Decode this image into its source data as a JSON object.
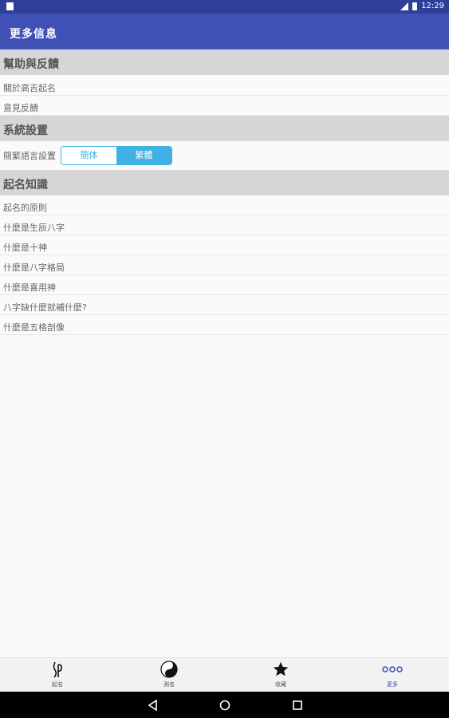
{
  "status_bar": {
    "time": "12:29"
  },
  "app_bar": {
    "title": "更多信息"
  },
  "sections": {
    "help": {
      "title": "幫助與反饋",
      "items": [
        "關於高吉起名",
        "意見反饋"
      ]
    },
    "system": {
      "title": "系統設置",
      "language_label": "簡繁語言設置",
      "options": [
        "簡体",
        "繁體"
      ],
      "selected": "繁體"
    },
    "knowledge": {
      "title": "起名知識",
      "items": [
        "起名的原則",
        "什麼是生辰八字",
        "什麼是十神",
        "什麼是八字格局",
        "什麼是喜用神",
        "八字缺什麼就補什麼?",
        "什麼是五格剖像"
      ]
    }
  },
  "bottom_nav": {
    "items": [
      {
        "label": "起名",
        "icon": "name-pen-icon"
      },
      {
        "label": "測名",
        "icon": "yin-yang-icon"
      },
      {
        "label": "收藏",
        "icon": "star-icon"
      },
      {
        "label": "更多",
        "icon": "more-dots-icon"
      }
    ],
    "active": "更多"
  },
  "colors": {
    "status_bar": "#2f3f99",
    "app_bar": "#3f51b5",
    "section_header": "#d6d6d6",
    "accent": "#3fb1e4"
  }
}
